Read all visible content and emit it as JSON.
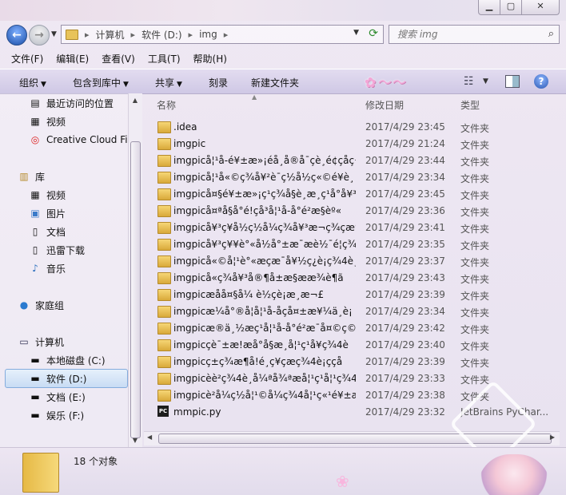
{
  "address": {
    "crumbs": [
      "计算机",
      "软件 (D:)",
      "img"
    ],
    "search_placeholder": "搜索 img"
  },
  "menu": [
    "文件(F)",
    "编辑(E)",
    "查看(V)",
    "工具(T)",
    "帮助(H)"
  ],
  "toolbar": {
    "organize": "组织",
    "include_library": "包含到库中",
    "share": "共享",
    "burn": "刻录",
    "new_folder": "新建文件夹"
  },
  "nav": {
    "recent": "最近访问的位置",
    "video_fav": "视频",
    "creative_cloud": "Creative Cloud Fil",
    "library": "库",
    "lib_video": "视频",
    "lib_pictures": "图片",
    "lib_docs": "文档",
    "lib_thunder": "迅雷下载",
    "lib_music": "音乐",
    "homegroup": "家庭组",
    "computer": "计算机",
    "drive_c": "本地磁盘 (C:)",
    "drive_d": "软件 (D:)",
    "drive_e": "文档 (E:)",
    "drive_f": "娱乐 (F:)"
  },
  "columns": {
    "name": "名称",
    "date": "修改日期",
    "type": "类型"
  },
  "files": [
    {
      "name": ".idea",
      "date": "2017/4/29 23:45",
      "type": "文件夹",
      "icon": "folder"
    },
    {
      "name": "imgpic",
      "date": "2017/4/29 21:24",
      "type": "文件夹",
      "icon": "folder"
    },
    {
      "name": "imgpicå¦¹å-é¥±æ»¡éå¸å®å¯çè¸é¢çåç¬",
      "date": "2017/4/29 23:44",
      "type": "文件夹",
      "icon": "folder"
    },
    {
      "name": "imgpicå¦¹å«©ç¾å¥²è¯ç½å½ç«©é¥è¸",
      "date": "2017/4/29 23:34",
      "type": "文件夹",
      "icon": "folder"
    },
    {
      "name": "imgpicå¤§é¥±æ»¡ç¹ç¾å§è¸æ¸ç¹å°å¥³è¡",
      "date": "2017/4/29 23:45",
      "type": "文件夹",
      "icon": "folder"
    },
    {
      "name": "imgpicå¤ªå§å°é!çå³å¦¹å-å°é²æ§èº«",
      "date": "2017/4/29 23:36",
      "type": "文件夹",
      "icon": "folder"
    },
    {
      "name": "imgpicå¥³ç¥å½ç½å¼ç¾å¥³æ¬ç¾çæ¶ä¹",
      "date": "2017/4/29 23:41",
      "type": "文件夹",
      "icon": "folder"
    },
    {
      "name": "imgpicå¥³ç¥¥è°«å½å°±æ¯æè½¯é¦ç¾4",
      "date": "2017/4/29 23:35",
      "type": "文件夹",
      "icon": "folder"
    },
    {
      "name": "imgpicå«©å¦¹è°«æçæ¯å¥½ç¿è¡ç¾4è¸å",
      "date": "2017/4/29 23:37",
      "type": "文件夹",
      "icon": "folder"
    },
    {
      "name": "imgpicå«ç¾å¥³å®¶å±æ§ææ¾è¶ã",
      "date": "2017/4/29 23:43",
      "type": "文件夹",
      "icon": "folder"
    },
    {
      "name": "imgpicæåå¤§å¼ è½çè¡æ¸æ¬£",
      "date": "2017/4/29 23:39",
      "type": "文件夹",
      "icon": "folder"
    },
    {
      "name": "imgpicæ¼å°®å¦å¦¹å-åçå¤±æ¥¼ä¸è¡",
      "date": "2017/4/29 23:34",
      "type": "文件夹",
      "icon": "folder"
    },
    {
      "name": "imgpicæ®ä¸½æç¹å¦¹å-å°é²æ¯å¤©ç©¿",
      "date": "2017/4/29 23:42",
      "type": "文件夹",
      "icon": "folder"
    },
    {
      "name": "imgpicçè¯±æ!æå°å§æ¸å¦¹ç¹å¥ç¾4è",
      "date": "2017/4/29 23:40",
      "type": "文件夹",
      "icon": "folder"
    },
    {
      "name": "imgpicç±ç¾æ¶å!é¸ç¥çæç¾4è¡ççå",
      "date": "2017/4/29 23:39",
      "type": "文件夹",
      "icon": "folder"
    },
    {
      "name": "imgpicèè²ç¾4è¸å¼ªå¾ªæå¦¹ç¹å¦¹ç¾4",
      "date": "2017/4/29 23:33",
      "type": "文件夹",
      "icon": "folder"
    },
    {
      "name": "imgpicè²å¼ç½å¦¹©å¼ç¾4å¦¹ç«¹é¥±æ»¡",
      "date": "2017/4/29 23:38",
      "type": "文件夹",
      "icon": "folder"
    },
    {
      "name": "mmpic.py",
      "date": "2017/4/29 23:32",
      "type": "JetBrains PyChar...",
      "icon": "pycharm"
    }
  ],
  "status": {
    "count": "18 个对象"
  }
}
